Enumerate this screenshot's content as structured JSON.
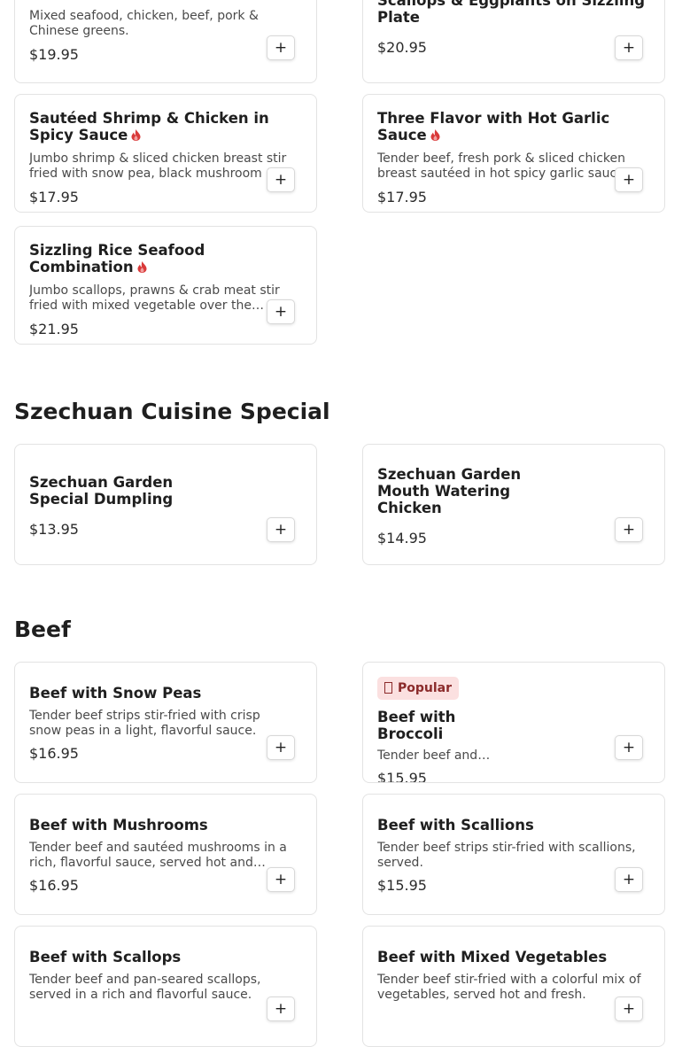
{
  "colors": {
    "accent_flame": "#d93a3a",
    "badge_bg": "#fbe0e0",
    "badge_text": "#8b2a2a"
  },
  "top_items": [
    {
      "name_tail": "",
      "desc": "Mixed seafood, chicken, beef, pork & Chinese greens.",
      "price": "$19.95"
    },
    {
      "name": "Scallops & Eggplants on Sizzling Plate",
      "price": "$20.95"
    }
  ],
  "items": [
    {
      "name": "Sautéed Shrimp & Chicken in Spicy Sauce",
      "spicy": true,
      "desc": "Jumbo shrimp & sliced chicken breast stir fried with snow pea, black mushroom & water chestnut.",
      "price": "$17.95"
    },
    {
      "name": "Three Flavor with Hot Garlic Sauce",
      "spicy": true,
      "desc": "Tender beef, fresh pork & sliced chicken breast sautéed in hot spicy garlic sauce.",
      "price": "$17.95"
    },
    {
      "name": "Sizzling Rice Seafood Combination",
      "spicy": true,
      "desc": "Jumbo scallops, prawns & crab meat stir fried with mixed vegetable over the sizzling rice.",
      "price": "$21.95"
    }
  ],
  "sections": {
    "szechuan": {
      "title": "Szechuan Cuisine Special",
      "items": [
        {
          "name": "Szechuan Garden Special Dumpling",
          "price": "$13.95"
        },
        {
          "name": "Szechuan Garden Mouth Watering Chicken",
          "price": "$14.95"
        }
      ]
    },
    "beef": {
      "title": "Beef",
      "items": [
        {
          "name": "Beef with Snow Peas",
          "desc": "Tender beef strips stir-fried with crisp snow peas in a light, flavorful sauce.",
          "price": "$16.95"
        },
        {
          "badge": "Popular",
          "name": "Beef with Broccoli",
          "desc": "Tender beef and…",
          "price": "$15.95"
        },
        {
          "name": "Beef with Mushrooms",
          "desc": "Tender beef and sautéed mushrooms in a rich, flavorful sauce, served hot and fresh.",
          "price": "$16.95"
        },
        {
          "name": "Beef with Scallions",
          "desc": "Tender beef strips stir-fried with scallions, served.",
          "price": "$15.95"
        },
        {
          "name": "Beef with Scallops",
          "desc": "Tender beef and pan-seared scallops, served in a rich and flavorful sauce.",
          "price": ""
        },
        {
          "name": "Beef with Mixed Vegetables",
          "desc": "Tender beef stir-fried with a colorful mix of vegetables, served hot and fresh.",
          "price": ""
        }
      ]
    }
  },
  "add_label": "+"
}
